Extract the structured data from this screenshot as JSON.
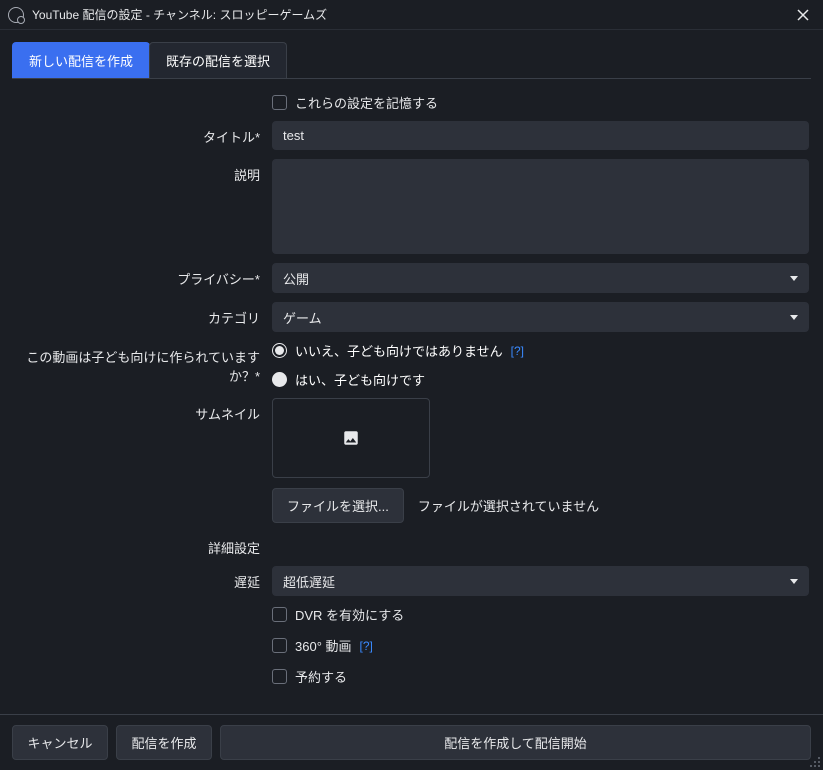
{
  "titlebar": {
    "title": "YouTube 配信の設定 - チャンネル: スロッピーゲームズ"
  },
  "tabs": {
    "new": "新しい配信を作成",
    "existing": "既存の配信を選択"
  },
  "form": {
    "remember_label": "これらの設定を記憶する",
    "title_label": "タイトル*",
    "title_value": "test",
    "desc_label": "説明",
    "desc_value": "",
    "privacy_label": "プライバシー*",
    "privacy_value": "公開",
    "category_label": "カテゴリ",
    "category_value": "ゲーム",
    "kids_label": "この動画は子ども向けに作られていますか？*",
    "kids_no": "いいえ、子ども向けではありません",
    "kids_yes": "はい、子ども向けです",
    "help_text": "[?]",
    "thumb_label": "サムネイル",
    "file_select": "ファイルを選択...",
    "file_none": "ファイルが選択されていません",
    "advanced_label": "詳細設定",
    "latency_label": "遅延",
    "latency_value": "超低遅延",
    "dvr_label": "DVR を有効にする",
    "v360_label": "360° 動画",
    "schedule_label": "予約する"
  },
  "footer": {
    "cancel": "キャンセル",
    "create": "配信を作成",
    "create_start": "配信を作成して配信開始"
  }
}
